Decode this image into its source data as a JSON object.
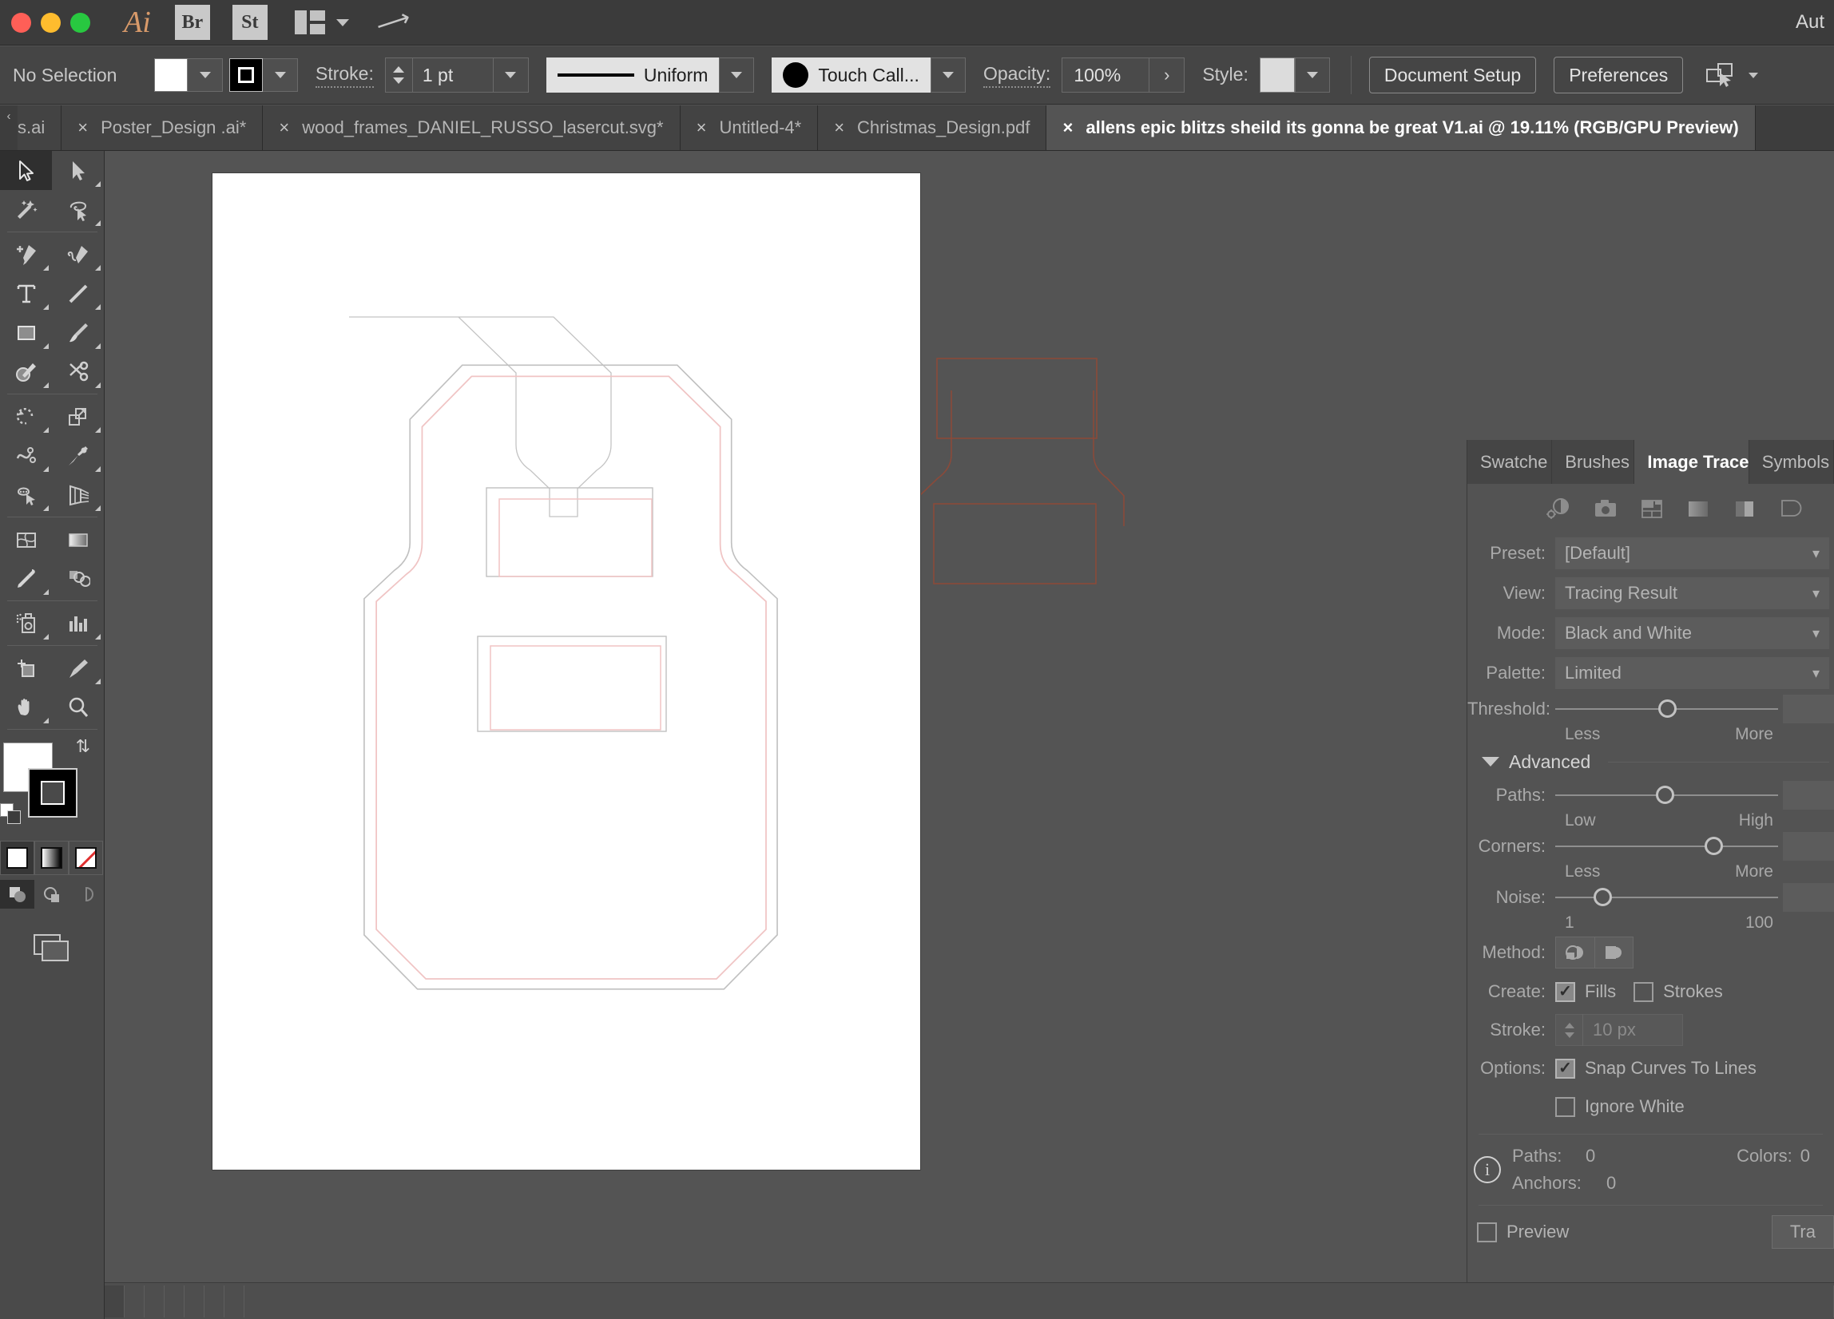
{
  "titlebar": {
    "app_name": "Ai",
    "bridge_label": "Br",
    "stock_label": "St",
    "right_label": "Aut"
  },
  "control_bar": {
    "selection_status": "No Selection",
    "stroke_label": "Stroke:",
    "stroke_weight": "1 pt",
    "stroke_profile": "Uniform",
    "brush_definition": "Touch Call...",
    "opacity_label": "Opacity:",
    "opacity_value": "100%",
    "opacity_arrow": "›",
    "style_label": "Style:",
    "document_setup": "Document Setup",
    "preferences": "Preferences"
  },
  "tabs": [
    {
      "label": "s.ai",
      "close": "×",
      "active": false,
      "clipped": true
    },
    {
      "label": "Poster_Design .ai*",
      "close": "×",
      "active": false
    },
    {
      "label": "wood_frames_DANIEL_RUSSO_lasercut.svg*",
      "close": "×",
      "active": false
    },
    {
      "label": "Untitled-4*",
      "close": "×",
      "active": false
    },
    {
      "label": "Christmas_Design.pdf",
      "close": "×",
      "active": false
    },
    {
      "label": "allens epic blitzs sheild its gonna be great V1.ai @ 19.11% (RGB/GPU Preview)",
      "close": "×",
      "active": true
    }
  ],
  "toolbar": {
    "tools": [
      {
        "name": "selection-tool",
        "active": true
      },
      {
        "name": "direct-selection-tool",
        "active": false
      },
      {
        "name": "magic-wand-tool",
        "active": false
      },
      {
        "name": "lasso-tool",
        "active": false
      },
      {
        "name": "pen-tool",
        "active": false
      },
      {
        "name": "curvature-tool",
        "active": false
      },
      {
        "name": "type-tool",
        "active": false
      },
      {
        "name": "line-segment-tool",
        "active": false
      },
      {
        "name": "rectangle-tool",
        "active": false
      },
      {
        "name": "paintbrush-tool",
        "active": false
      },
      {
        "name": "shaper-tool",
        "active": false
      },
      {
        "name": "scissors-tool",
        "active": false
      },
      {
        "name": "rotate-tool",
        "active": false
      },
      {
        "name": "scale-tool",
        "active": false
      },
      {
        "name": "width-tool",
        "active": false
      },
      {
        "name": "free-transform-tool",
        "active": false
      },
      {
        "name": "shape-builder-tool",
        "active": false
      },
      {
        "name": "perspective-grid-tool",
        "active": false
      },
      {
        "name": "mesh-tool",
        "active": false
      },
      {
        "name": "gradient-tool",
        "active": false
      },
      {
        "name": "eyedropper-tool",
        "active": false
      },
      {
        "name": "blend-tool",
        "active": false
      },
      {
        "name": "symbol-sprayer-tool",
        "active": false
      },
      {
        "name": "column-graph-tool",
        "active": false
      },
      {
        "name": "artboard-tool",
        "active": false
      },
      {
        "name": "slice-tool",
        "active": false
      },
      {
        "name": "hand-tool",
        "active": false
      },
      {
        "name": "zoom-tool",
        "active": false
      }
    ]
  },
  "panel": {
    "tabs": [
      {
        "label": "Swatche",
        "active": false
      },
      {
        "label": "Brushes",
        "active": false
      },
      {
        "label": "Image Trace",
        "active": true
      },
      {
        "label": "Symbols",
        "active": false
      }
    ],
    "preset_icons": [
      "auto-color-icon",
      "high-fidelity-photo-icon",
      "low-fidelity-photo-icon",
      "three-colors-icon",
      "grayscale-icon",
      "silhouettes-icon"
    ],
    "fields": {
      "preset_label": "Preset:",
      "preset_value": "[Default]",
      "view_label": "View:",
      "view_value": "Tracing Result",
      "mode_label": "Mode:",
      "mode_value": "Black and White",
      "palette_label": "Palette:",
      "palette_value": "Limited"
    },
    "sliders": {
      "threshold_label": "Threshold:",
      "threshold_min_label": "Less",
      "threshold_max_label": "More",
      "threshold_percent": 50,
      "paths_label": "Paths:",
      "paths_min_label": "Low",
      "paths_max_label": "High",
      "paths_percent": 49,
      "corners_label": "Corners:",
      "corners_min_label": "Less",
      "corners_max_label": "More",
      "corners_percent": 71,
      "noise_label": "Noise:",
      "noise_min_label": "1",
      "noise_max_label": "100",
      "noise_percent": 21
    },
    "advanced_label": "Advanced",
    "method_label": "Method:",
    "method_options": [
      "abutting-method-icon",
      "overlapping-method-icon"
    ],
    "create_label": "Create:",
    "create_fills_label": "Fills",
    "create_fills_checked": true,
    "create_strokes_label": "Strokes",
    "create_strokes_checked": false,
    "stroke_label": "Stroke:",
    "stroke_value": "10 px",
    "options_label": "Options:",
    "snap_curves_label": "Snap Curves To Lines",
    "snap_curves_checked": true,
    "ignore_white_label": "Ignore White",
    "ignore_white_checked": false,
    "info": {
      "paths_label": "Paths:",
      "paths_value": "0",
      "colors_label": "Colors:",
      "colors_value": "0",
      "anchors_label": "Anchors:",
      "anchors_value": "0"
    },
    "preview_label": "Preview",
    "preview_checked": false,
    "trace_button": "Tra"
  },
  "colors": {
    "window_chrome": "#3b3b3b",
    "control_bar": "#454545",
    "canvas_bg": "#545454",
    "panel_bg": "#535353",
    "artboard": "#ffffff",
    "artwork_gray_stroke": "#b9b9b9",
    "artwork_pink_stroke": "#f3c6c6",
    "offboard_stroke": "#8a4a3a",
    "accent_orange": "#d89a6a",
    "traffic_red": "#ff5f57",
    "traffic_yellow": "#febc2e",
    "traffic_green": "#28c840"
  }
}
